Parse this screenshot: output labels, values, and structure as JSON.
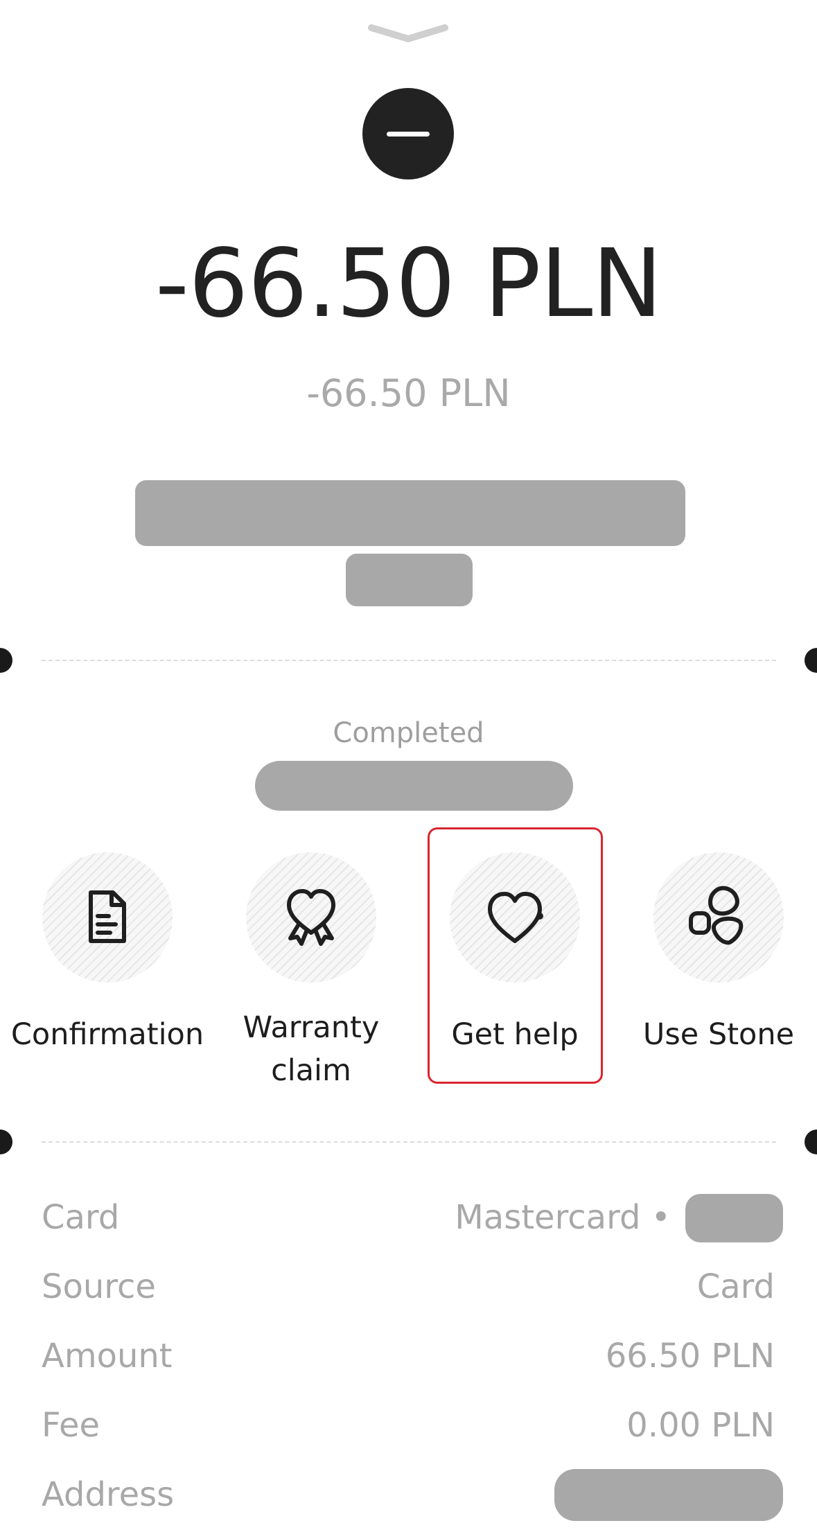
{
  "transaction": {
    "amount": "-66.50 PLN",
    "amount_secondary": "-66.50 PLN",
    "status": "Completed"
  },
  "actions": [
    {
      "label": "Confirmation",
      "icon": "document-icon"
    },
    {
      "label": "Warranty claim",
      "icon": "heart-ribbon-icon"
    },
    {
      "label": "Get help",
      "icon": "heart-help-icon"
    },
    {
      "label": "Use Stone",
      "icon": "stones-icon"
    }
  ],
  "details": {
    "card": {
      "label": "Card",
      "value": "Mastercard •"
    },
    "source": {
      "label": "Source",
      "value": "Card"
    },
    "amount": {
      "label": "Amount",
      "value": "66.50 PLN"
    },
    "fee": {
      "label": "Fee",
      "value": "0.00 PLN"
    },
    "address": {
      "label": "Address",
      "value": ""
    }
  },
  "colors": {
    "highlight": "#d7262f",
    "text_primary": "#222222",
    "text_muted": "#a8a8a8",
    "redaction": "#a8a8a8"
  }
}
